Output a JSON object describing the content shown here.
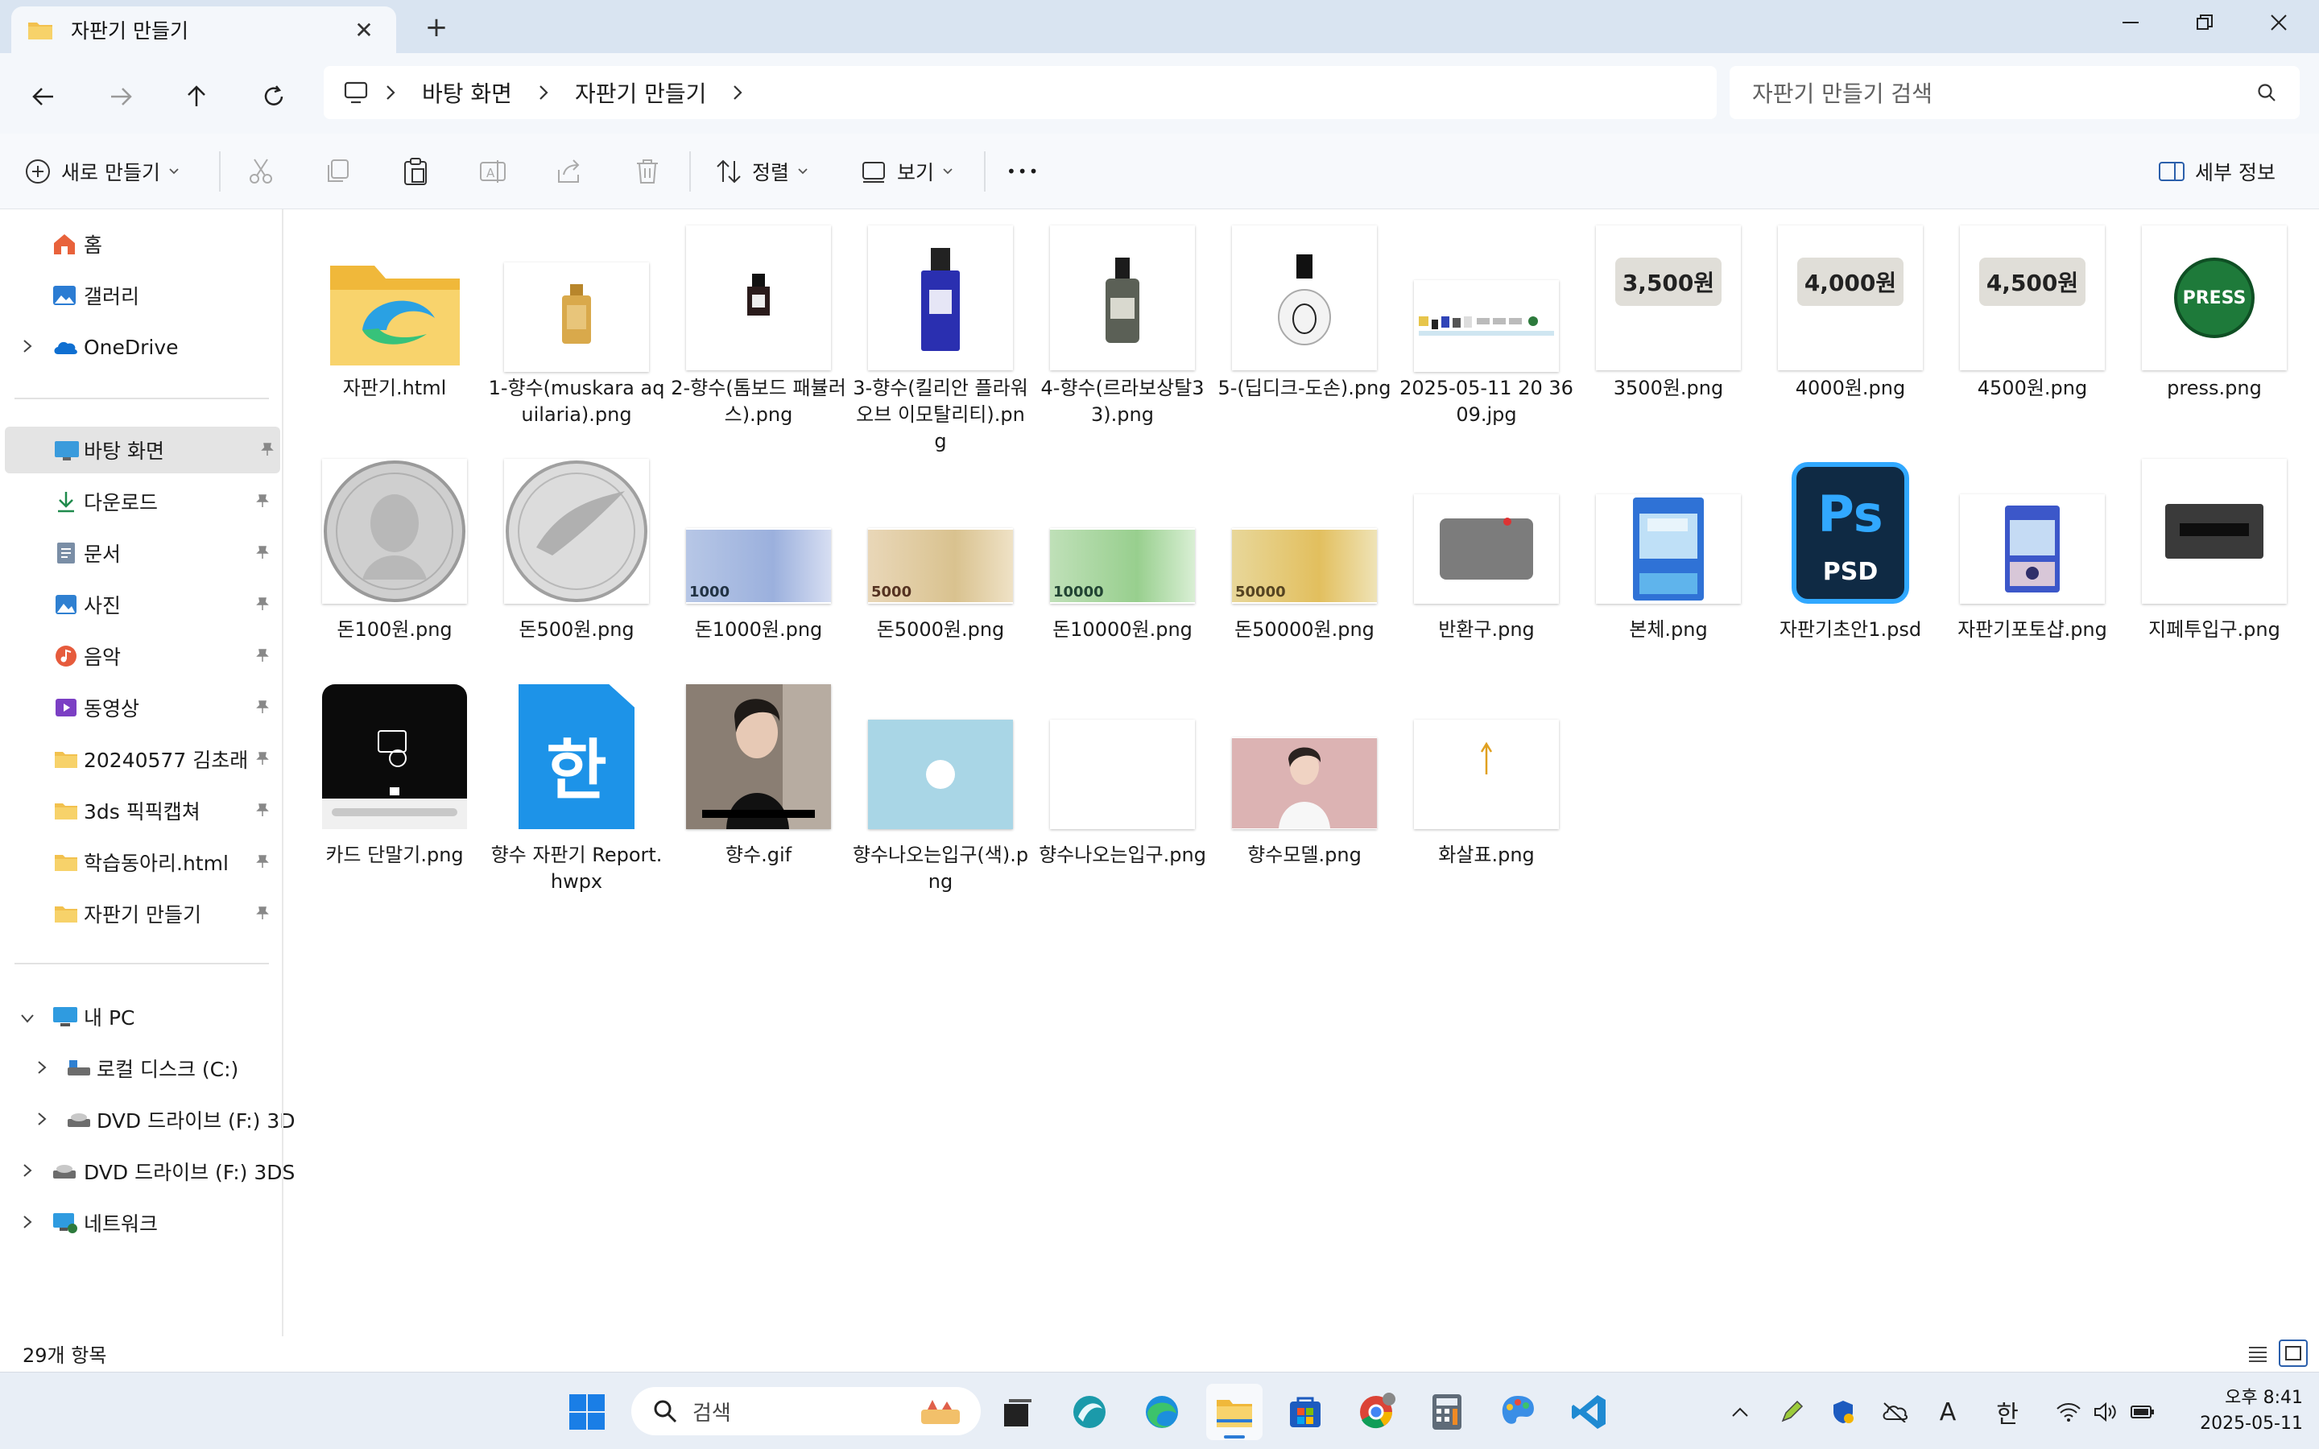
{
  "window": {
    "tab_title": "자판기 만들기",
    "new_tab": "+",
    "tab_close": "✕"
  },
  "nav": {
    "breadcrumb": [
      "바탕 화면",
      "자판기 만들기"
    ],
    "search_placeholder": "자판기 만들기 검색"
  },
  "toolbar": {
    "new_label": "새로 만들기",
    "sort_label": "정렬",
    "view_label": "보기",
    "more_label": "•••",
    "details_label": "세부 정보"
  },
  "sidebar": {
    "top": [
      {
        "label": "홈",
        "icon": "home-icon"
      },
      {
        "label": "갤러리",
        "icon": "gallery-icon"
      },
      {
        "label": "OneDrive",
        "icon": "onedrive-icon"
      }
    ],
    "pinned": [
      {
        "label": "바탕 화면",
        "icon": "desktop-icon"
      },
      {
        "label": "다운로드",
        "icon": "download-icon"
      },
      {
        "label": "문서",
        "icon": "documents-icon"
      },
      {
        "label": "사진",
        "icon": "pictures-icon"
      },
      {
        "label": "음악",
        "icon": "music-icon"
      },
      {
        "label": "동영상",
        "icon": "videos-icon"
      },
      {
        "label": "20240577 김초래",
        "icon": "folder-icon"
      },
      {
        "label": "3ds 픽픽캡쳐",
        "icon": "folder-icon"
      },
      {
        "label": "학습동아리.html",
        "icon": "folder-icon"
      },
      {
        "label": "자판기 만들기",
        "icon": "folder-icon"
      }
    ],
    "pc": [
      {
        "label": "내 PC",
        "icon": "pc-icon"
      },
      {
        "label": "로컬 디스크 (C:)",
        "icon": "drive-icon"
      },
      {
        "label": "DVD 드라이브 (F:) 3D",
        "icon": "dvd-icon"
      },
      {
        "label": "DVD 드라이브 (F:) 3DS",
        "icon": "dvd-icon"
      },
      {
        "label": "네트워크",
        "icon": "network-icon"
      }
    ]
  },
  "files": [
    {
      "name": "자판기.html"
    },
    {
      "name": "1-향수(muskara aquilaria).png"
    },
    {
      "name": "2-향수(톰보드 패뷸러스).png"
    },
    {
      "name": "3-향수(킬리안 플라워 오브 이모탈리티).png"
    },
    {
      "name": "4-향수(르라보상탈33).png"
    },
    {
      "name": "5-(딥디크-도손).png"
    },
    {
      "name": "2025-05-11 20 36 09.jpg"
    },
    {
      "name": "3500원.png",
      "price_text": "3,500원"
    },
    {
      "name": "4000원.png",
      "price_text": "4,000원"
    },
    {
      "name": "4500원.png",
      "price_text": "4,500원"
    },
    {
      "name": "press.png",
      "press_text": "PRESS"
    },
    {
      "name": "돈100원.png"
    },
    {
      "name": "돈500원.png"
    },
    {
      "name": "돈1000원.png",
      "denom": "1000"
    },
    {
      "name": "돈5000원.png",
      "denom": "5000"
    },
    {
      "name": "돈10000원.png",
      "denom": "10000"
    },
    {
      "name": "돈50000원.png",
      "denom": "50000"
    },
    {
      "name": "반환구.png"
    },
    {
      "name": "본체.png"
    },
    {
      "name": "자판기초안1.psd",
      "ps_text": "Ps",
      "psd_text": "PSD"
    },
    {
      "name": "자판기포토샵.png"
    },
    {
      "name": "지페투입구.png"
    },
    {
      "name": "카드 단말기.png"
    },
    {
      "name": "향수 자판기 Report.hwpx",
      "hwp_text": "한"
    },
    {
      "name": "향수.gif"
    },
    {
      "name": "향수나오는입구(색).png"
    },
    {
      "name": "향수나오는입구.png"
    },
    {
      "name": "향수모델.png"
    },
    {
      "name": "화살표.png"
    }
  ],
  "status": {
    "item_count": "29개 항목"
  },
  "taskbar": {
    "search_label": "검색",
    "ime_a": "A",
    "ime_han": "한",
    "time": "오후 8:41",
    "date": "2025-05-11"
  }
}
